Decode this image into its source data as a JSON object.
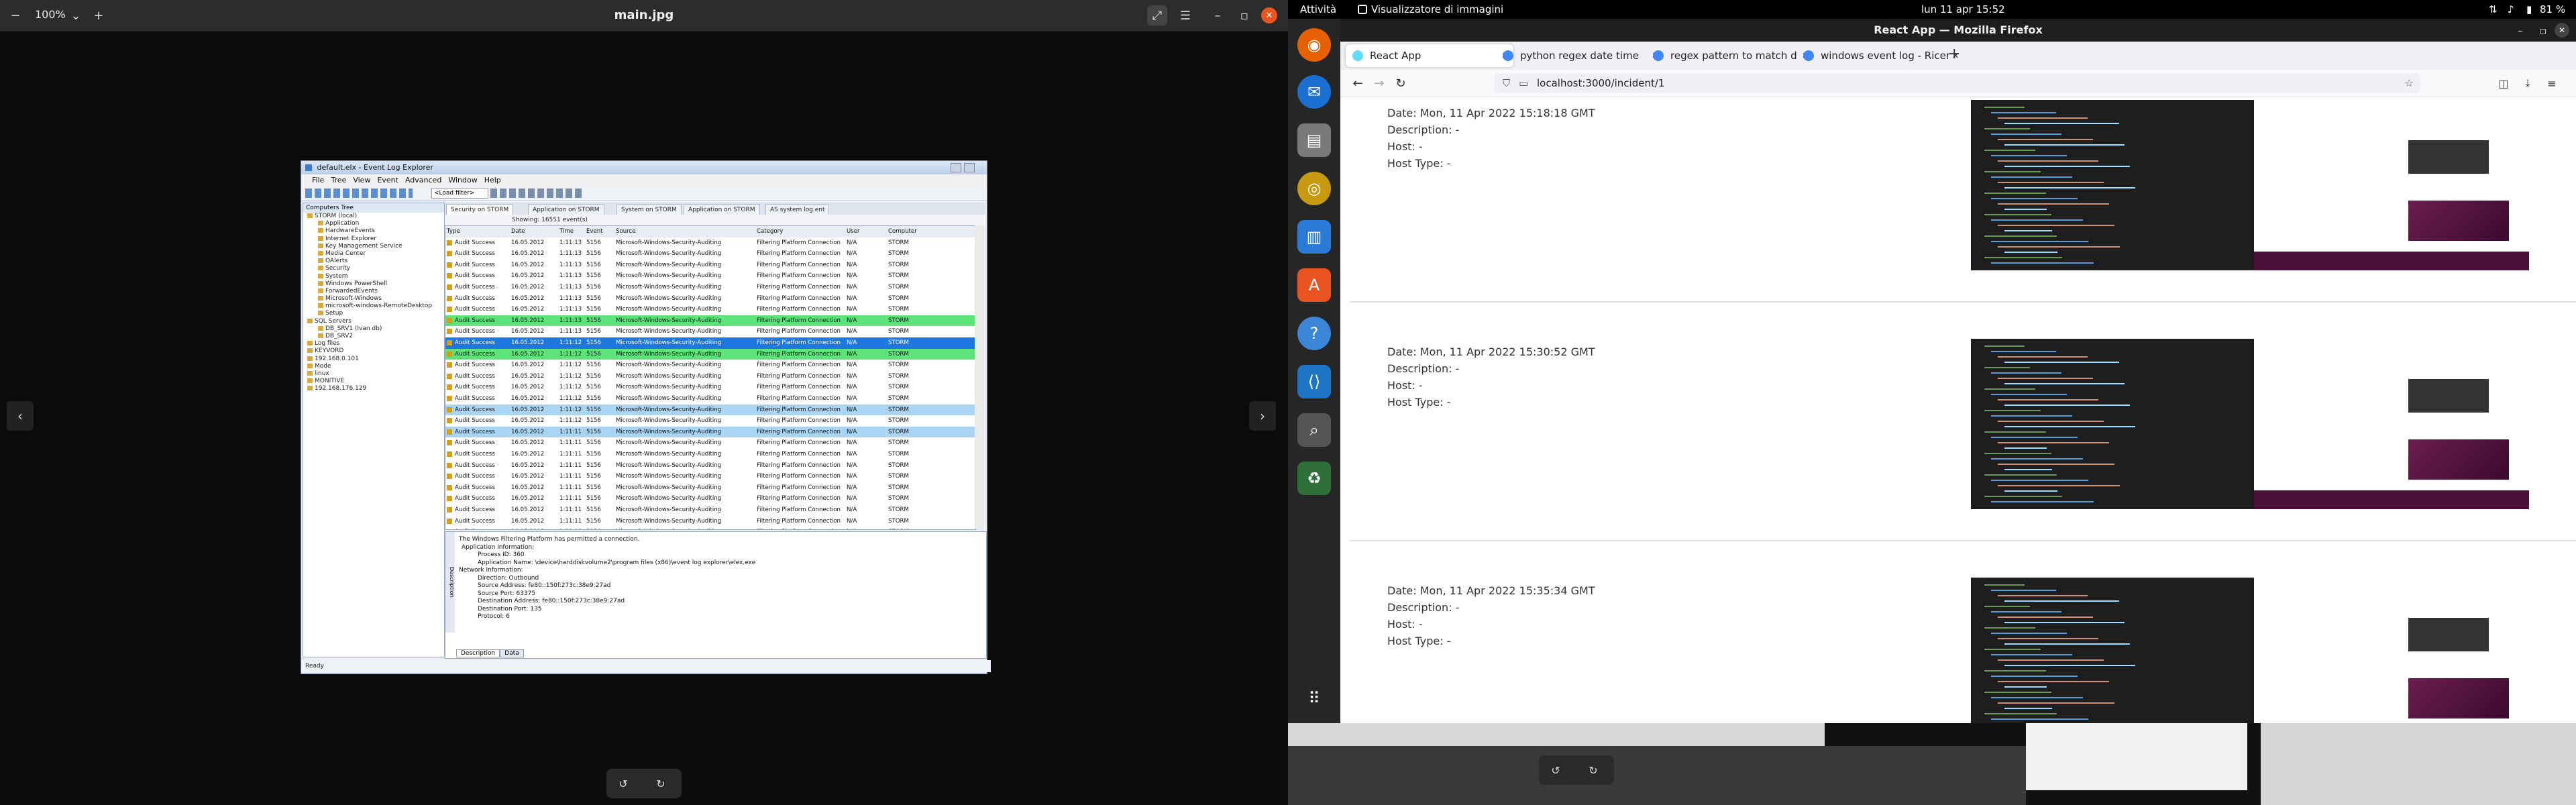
{
  "viewer": {
    "zoom": "100%",
    "title": "main.jpg"
  },
  "eventlog": {
    "window_title": "default.elx - Event Log Explorer",
    "menu": [
      "File",
      "Tree",
      "View",
      "Event",
      "Advanced",
      "Window",
      "Help"
    ],
    "filter_label": "<Load filter>",
    "tree_header": "Computers Tree",
    "tree": [
      "STORM (local)",
      "Application",
      "HardwareEvents",
      "Internet Explorer",
      "Key Management Service",
      "Media Center",
      "OAlerts",
      "Security",
      "System",
      "Windows PowerShell",
      "ForwardedEvents",
      "Microsoft-Windows",
      "microsoft-windows-RemoteDesktop",
      "Setup",
      "SQL Servers",
      "DB_SRV1 (Ivan db)",
      "DB_SRV2",
      "Log files",
      "KEYVORD",
      "192.168.0.101",
      "Mode",
      "linux",
      "MONITIVE",
      "192.168.176.129"
    ],
    "tabs": [
      "Security on STORM",
      "Application on STORM",
      "System on STORM",
      "Application on STORM",
      "AS system log.ent"
    ],
    "list_status": "Showing: 16551 event(s)",
    "columns": [
      "Type",
      "Date",
      "Time",
      "Event",
      "Source",
      "Category",
      "User",
      "Computer"
    ],
    "rows": [
      {
        "type": "Audit Success",
        "date": "16.05.2012",
        "time": "1:11:13",
        "event": "5156",
        "source": "Microsoft-Windows-Security-Auditing",
        "category": "Filtering Platform Connection",
        "user": "N/A",
        "computer": "STORM"
      },
      {
        "type": "Audit Success",
        "date": "16.05.2012",
        "time": "1:11:13",
        "event": "5156",
        "source": "Microsoft-Windows-Security-Auditing",
        "category": "Filtering Platform Connection",
        "user": "N/A",
        "computer": "STORM"
      },
      {
        "type": "Audit Success",
        "date": "16.05.2012",
        "time": "1:11:13",
        "event": "5156",
        "source": "Microsoft-Windows-Security-Auditing",
        "category": "Filtering Platform Connection",
        "user": "N/A",
        "computer": "STORM"
      },
      {
        "type": "Audit Success",
        "date": "16.05.2012",
        "time": "1:11:13",
        "event": "5156",
        "source": "Microsoft-Windows-Security-Auditing",
        "category": "Filtering Platform Connection",
        "user": "N/A",
        "computer": "STORM"
      },
      {
        "type": "Audit Success",
        "date": "16.05.2012",
        "time": "1:11:13",
        "event": "5156",
        "source": "Microsoft-Windows-Security-Auditing",
        "category": "Filtering Platform Connection",
        "user": "N/A",
        "computer": "STORM"
      },
      {
        "type": "Audit Success",
        "date": "16.05.2012",
        "time": "1:11:13",
        "event": "5156",
        "source": "Microsoft-Windows-Security-Auditing",
        "category": "Filtering Platform Connection",
        "user": "N/A",
        "computer": "STORM"
      },
      {
        "type": "Audit Success",
        "date": "16.05.2012",
        "time": "1:11:13",
        "event": "5156",
        "source": "Microsoft-Windows-Security-Auditing",
        "category": "Filtering Platform Connection",
        "user": "N/A",
        "computer": "STORM"
      },
      {
        "type": "Audit Success",
        "date": "16.05.2012",
        "time": "1:11:13",
        "event": "5156",
        "source": "Microsoft-Windows-Security-Auditing",
        "category": "Filtering Platform Connection",
        "user": "N/A",
        "computer": "STORM",
        "hl": "green"
      },
      {
        "type": "Audit Success",
        "date": "16.05.2012",
        "time": "1:11:13",
        "event": "5156",
        "source": "Microsoft-Windows-Security-Auditing",
        "category": "Filtering Platform Connection",
        "user": "N/A",
        "computer": "STORM"
      },
      {
        "type": "Audit Success",
        "date": "16.05.2012",
        "time": "1:11:12",
        "event": "5156",
        "source": "Microsoft-Windows-Security-Auditing",
        "category": "Filtering Platform Connection",
        "user": "N/A",
        "computer": "STORM",
        "hl": "blue"
      },
      {
        "type": "Audit Success",
        "date": "16.05.2012",
        "time": "1:11:12",
        "event": "5156",
        "source": "Microsoft-Windows-Security-Auditing",
        "category": "Filtering Platform Connection",
        "user": "N/A",
        "computer": "STORM",
        "hl": "green"
      },
      {
        "type": "Audit Success",
        "date": "16.05.2012",
        "time": "1:11:12",
        "event": "5156",
        "source": "Microsoft-Windows-Security-Auditing",
        "category": "Filtering Platform Connection",
        "user": "N/A",
        "computer": "STORM"
      },
      {
        "type": "Audit Success",
        "date": "16.05.2012",
        "time": "1:11:12",
        "event": "5156",
        "source": "Microsoft-Windows-Security-Auditing",
        "category": "Filtering Platform Connection",
        "user": "N/A",
        "computer": "STORM"
      },
      {
        "type": "Audit Success",
        "date": "16.05.2012",
        "time": "1:11:12",
        "event": "5156",
        "source": "Microsoft-Windows-Security-Auditing",
        "category": "Filtering Platform Connection",
        "user": "N/A",
        "computer": "STORM"
      },
      {
        "type": "Audit Success",
        "date": "16.05.2012",
        "time": "1:11:12",
        "event": "5156",
        "source": "Microsoft-Windows-Security-Auditing",
        "category": "Filtering Platform Connection",
        "user": "N/A",
        "computer": "STORM"
      },
      {
        "type": "Audit Success",
        "date": "16.05.2012",
        "time": "1:11:12",
        "event": "5156",
        "source": "Microsoft-Windows-Security-Auditing",
        "category": "Filtering Platform Connection",
        "user": "N/A",
        "computer": "STORM",
        "hl": "light"
      },
      {
        "type": "Audit Success",
        "date": "16.05.2012",
        "time": "1:11:12",
        "event": "5156",
        "source": "Microsoft-Windows-Security-Auditing",
        "category": "Filtering Platform Connection",
        "user": "N/A",
        "computer": "STORM"
      },
      {
        "type": "Audit Success",
        "date": "16.05.2012",
        "time": "1:11:11",
        "event": "5156",
        "source": "Microsoft-Windows-Security-Auditing",
        "category": "Filtering Platform Connection",
        "user": "N/A",
        "computer": "STORM",
        "hl": "light"
      },
      {
        "type": "Audit Success",
        "date": "16.05.2012",
        "time": "1:11:11",
        "event": "5156",
        "source": "Microsoft-Windows-Security-Auditing",
        "category": "Filtering Platform Connection",
        "user": "N/A",
        "computer": "STORM"
      },
      {
        "type": "Audit Success",
        "date": "16.05.2012",
        "time": "1:11:11",
        "event": "5156",
        "source": "Microsoft-Windows-Security-Auditing",
        "category": "Filtering Platform Connection",
        "user": "N/A",
        "computer": "STORM"
      },
      {
        "type": "Audit Success",
        "date": "16.05.2012",
        "time": "1:11:11",
        "event": "5156",
        "source": "Microsoft-Windows-Security-Auditing",
        "category": "Filtering Platform Connection",
        "user": "N/A",
        "computer": "STORM"
      },
      {
        "type": "Audit Success",
        "date": "16.05.2012",
        "time": "1:11:11",
        "event": "5156",
        "source": "Microsoft-Windows-Security-Auditing",
        "category": "Filtering Platform Connection",
        "user": "N/A",
        "computer": "STORM"
      },
      {
        "type": "Audit Success",
        "date": "16.05.2012",
        "time": "1:11:11",
        "event": "5156",
        "source": "Microsoft-Windows-Security-Auditing",
        "category": "Filtering Platform Connection",
        "user": "N/A",
        "computer": "STORM"
      },
      {
        "type": "Audit Success",
        "date": "16.05.2012",
        "time": "1:11:11",
        "event": "5156",
        "source": "Microsoft-Windows-Security-Auditing",
        "category": "Filtering Platform Connection",
        "user": "N/A",
        "computer": "STORM"
      },
      {
        "type": "Audit Success",
        "date": "16.05.2012",
        "time": "1:11:11",
        "event": "5156",
        "source": "Microsoft-Windows-Security-Auditing",
        "category": "Filtering Platform Connection",
        "user": "N/A",
        "computer": "STORM"
      },
      {
        "type": "Audit Success",
        "date": "16.05.2012",
        "time": "1:11:11",
        "event": "5156",
        "source": "Microsoft-Windows-Security-Auditing",
        "category": "Filtering Platform Connection",
        "user": "N/A",
        "computer": "STORM"
      },
      {
        "type": "Audit Success",
        "date": "16.05.2012",
        "time": "1:11:11",
        "event": "5156",
        "source": "Microsoft-Windows-Security-Auditing",
        "category": "Filtering Platform Connection",
        "user": "N/A",
        "computer": "STORM"
      }
    ],
    "description_lines": [
      "The Windows Filtering Platform has permitted a connection.",
      "Application Information:",
      "Process ID:           360",
      "Application Name:     \\device\\harddiskvolume2\\program files (x86)\\event log explorer\\elex.exe",
      "Network Information:",
      "Direction:            Outbound",
      "Source Address:       fe80::150f:273c:38e9:27ad",
      "Source Port:          63375",
      "Destination Address:  fe80::150f:273c:38e9:27ad",
      "Destination Port:     135",
      "Protocol:             6"
    ],
    "desc_tabs": [
      "Description",
      "Data"
    ],
    "desc_side_label": "Description",
    "status": "Ready"
  },
  "ubuntu": {
    "activities": "Attività",
    "app_name": "Visualizzatore di immagini",
    "clock": "lun 11 apr  15:52",
    "battery": "81 %"
  },
  "firefox": {
    "window_title": "React App — Mozilla Firefox",
    "tabs": [
      "React App",
      "python regex date time",
      "regex pattern to match d",
      "windows event log - Ricer"
    ],
    "url": "localhost:3000/incident/1",
    "incidents": [
      {
        "date": "Date: Mon, 11 Apr 2022 15:18:18 GMT",
        "description": "Description: -",
        "host": "Host: -",
        "host_type": "Host Type: -"
      },
      {
        "date": "Date: Mon, 11 Apr 2022 15:30:52 GMT",
        "description": "Description: -",
        "host": "Host: -",
        "host_type": "Host Type: -"
      },
      {
        "date": "Date: Mon, 11 Apr 2022 15:35:34 GMT",
        "description": "Description: -",
        "host": "Host: -",
        "host_type": "Host Type: -"
      }
    ]
  },
  "colors": {
    "row_green": "#5ee27a",
    "row_blue": "#1f78e0",
    "row_light": "#a9d4f2",
    "ubuntu_accent": "#e95420"
  }
}
